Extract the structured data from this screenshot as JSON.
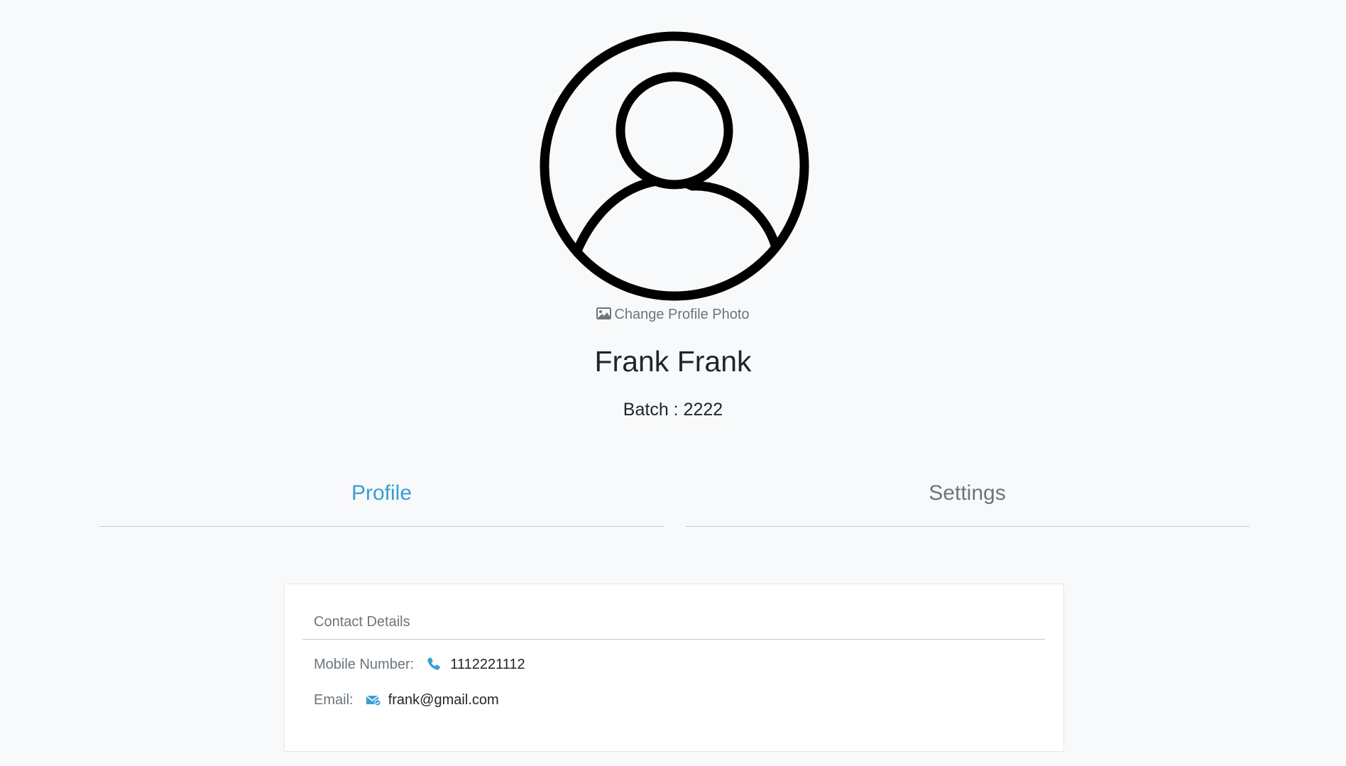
{
  "profile": {
    "change_photo_label": "Change Profile Photo",
    "name": "Frank Frank",
    "batch_text": "Batch : 2222"
  },
  "tabs": [
    {
      "label": "Profile",
      "active": true
    },
    {
      "label": "Settings",
      "active": false
    }
  ],
  "contact": {
    "header": "Contact Details",
    "mobile_label": "Mobile Number:",
    "mobile_value": "1112221112",
    "email_label": "Email:",
    "email_value": "frank@gmail.com"
  },
  "icons": {
    "avatar": "user-circle-icon",
    "change_photo": "image-icon",
    "mobile": "phone-icon",
    "email": "envelope-icon"
  },
  "colors": {
    "accent": "#3a9fd4",
    "muted": "#6c757d",
    "text": "#212529",
    "background": "#f8f9fa"
  }
}
